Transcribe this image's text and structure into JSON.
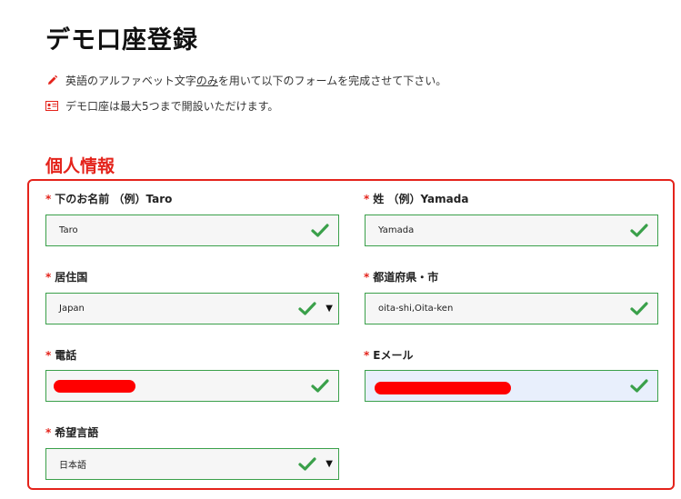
{
  "page": {
    "title": "デモ口座登録",
    "notes": [
      {
        "icon": "pencil-icon",
        "text_pre": "英語のアルファベット文字",
        "text_ul": "のみ",
        "text_post": "を用いて以下のフォームを完成させて下さい。"
      },
      {
        "icon": "id-card-icon",
        "text": "デモ口座は最大5つまで開設いただけます。"
      }
    ]
  },
  "section": {
    "title": "個人情報"
  },
  "colors": {
    "accent": "#e4231b",
    "valid_border": "#3aa04a",
    "valid_check": "#3aa04a",
    "redaction": "#ff0000"
  },
  "fields": {
    "first_name": {
      "required_mark": "*",
      "label": "下のお名前 （例）Taro",
      "value": "Taro"
    },
    "last_name": {
      "required_mark": "*",
      "label": "姓 （例）Yamada",
      "value": "Yamada"
    },
    "country": {
      "required_mark": "*",
      "label": "居住国",
      "value": "Japan",
      "caret": "▼"
    },
    "city": {
      "required_mark": "*",
      "label": "都道府県・市",
      "value": "oita-shi,Oita-ken"
    },
    "phone": {
      "required_mark": "*",
      "label": "電話",
      "value_redacted": true
    },
    "email": {
      "required_mark": "*",
      "label": "Eメール",
      "value_redacted": true
    },
    "language": {
      "required_mark": "*",
      "label": "希望言語",
      "value": "日本語",
      "caret": "▼"
    }
  }
}
